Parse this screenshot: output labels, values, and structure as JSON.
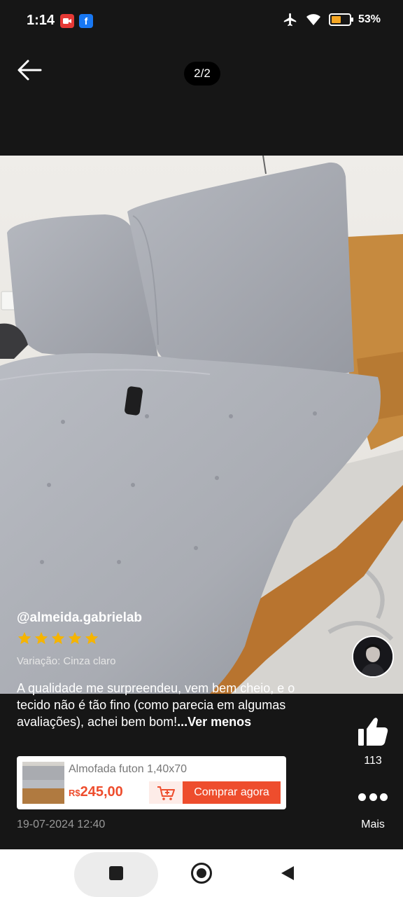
{
  "status_bar": {
    "time": "1:14",
    "battery": "53%",
    "battery_level": 0.53,
    "icons": [
      "video-record-notification-icon",
      "facebook-notification-icon",
      "airplane-mode-icon",
      "wifi-icon",
      "battery-icon"
    ]
  },
  "header": {
    "counter": "2/2",
    "back_icon": "arrow-left-icon"
  },
  "review": {
    "username": "@almeida.gabrielab",
    "rating": 5,
    "variation": "Variação: Cinza claro",
    "text": "A qualidade me surpreendeu, vem bem cheio, e o tecido não é tão fino (como parecia em algumas avaliações), achei bem bom!",
    "toggle_label": "...Ver menos",
    "date": "19-07-2024 12:40"
  },
  "side_actions": {
    "likes": "113",
    "more_label": "Mais"
  },
  "product": {
    "name": "Almofada futon 1,40x70",
    "currency": "R$",
    "price": "245,00",
    "buy_label": "Comprar agora"
  },
  "colors": {
    "accent": "#ee4d2d",
    "star": "#f5b400",
    "background": "#161616"
  }
}
